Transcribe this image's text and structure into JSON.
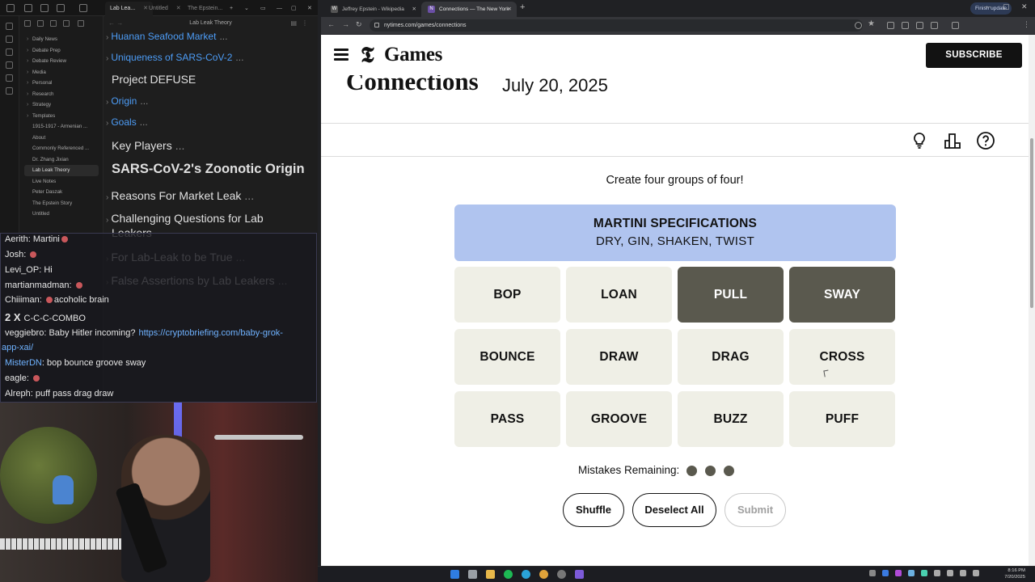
{
  "obsidian": {
    "tabs": [
      {
        "label": "Lab Lea..."
      },
      {
        "label": "Untitled"
      },
      {
        "label": "The Epstein..."
      }
    ],
    "note_title": "Lab Leak Theory",
    "file_tree": [
      {
        "label": "Daily News",
        "folder": true
      },
      {
        "label": "Debate Prep",
        "folder": true
      },
      {
        "label": "Debate Review",
        "folder": true
      },
      {
        "label": "Media",
        "folder": true
      },
      {
        "label": "Personal",
        "folder": true
      },
      {
        "label": "Research",
        "folder": true
      },
      {
        "label": "Strategy",
        "folder": true
      },
      {
        "label": "Templates",
        "folder": true
      },
      {
        "label": "1915-1917 - Armenian ...",
        "folder": false
      },
      {
        "label": "About",
        "folder": false
      },
      {
        "label": "Commonly Referenced ...",
        "folder": false
      },
      {
        "label": "Dr. Zhang Jixian",
        "folder": false
      },
      {
        "label": "Lab Leak Theory",
        "folder": false,
        "active": true
      },
      {
        "label": "Live Notes",
        "folder": false
      },
      {
        "label": "Peter Daszak",
        "folder": false
      },
      {
        "label": "The Epstein Story",
        "folder": false
      },
      {
        "label": "Untitled",
        "folder": false
      }
    ],
    "outline": [
      {
        "label": "Huanan Seafood Market",
        "link": true,
        "caret": true,
        "ell": "...",
        "size": 12
      },
      {
        "label": "Uniqueness of SARS-CoV-2",
        "link": true,
        "caret": true,
        "ell": "...",
        "size": 12
      },
      {
        "label": "Project DEFUSE",
        "link": false,
        "caret": false,
        "ell": "",
        "size": 14
      },
      {
        "label": "Origin",
        "link": true,
        "caret": true,
        "ell": "...",
        "size": 12
      },
      {
        "label": "Goals",
        "link": true,
        "caret": true,
        "ell": "...",
        "size": 12
      },
      {
        "label": "Key Players",
        "link": false,
        "caret": false,
        "ell": "...",
        "size": 14
      },
      {
        "label": "SARS-CoV-2's Zoonotic Origin",
        "link": false,
        "caret": false,
        "ell": "",
        "size": 16.5,
        "bold": true
      },
      {
        "label": "Reasons For Market Leak",
        "link": false,
        "caret": true,
        "ell": "...",
        "size": 14
      },
      {
        "label": "Challenging Questions for Lab",
        "link": false,
        "caret": true,
        "ell": "",
        "size": 14
      },
      {
        "label": "Leakers",
        "link": false,
        "caret": false,
        "ell": "",
        "size": 14
      },
      {
        "label": "For Lab-Leak to be True",
        "link": false,
        "caret": true,
        "ell": "...",
        "size": 14
      },
      {
        "label": "False Assertions by Lab Leakers",
        "link": false,
        "caret": true,
        "ell": "...",
        "size": 14
      }
    ]
  },
  "chat": {
    "messages": [
      {
        "user": "Aerith",
        "text": "Martini"
      },
      {
        "user": "Josh",
        "text": ""
      },
      {
        "user": "Levi_OP",
        "text": "Hi"
      },
      {
        "user": "martianmadman",
        "text": ""
      },
      {
        "user": "Chiiiman",
        "text": "acoholic brain"
      },
      {
        "combo_count": "2 X",
        "combo_text": "C-C-C-COMBO"
      },
      {
        "user": "veggiebro",
        "text": "Baby Hitler incoming?",
        "link": "https://cryptobriefing.com/baby-grok-",
        "link2": "app-xai/"
      },
      {
        "user": "MisterDN",
        "text": "bop bounce groove sway",
        "blue": true
      },
      {
        "user": "eagle",
        "text": ""
      },
      {
        "user": "Alreph",
        "text": "puff pass drag draw"
      }
    ]
  },
  "browser": {
    "tabs": [
      {
        "label": "Jeffrey Epstein - Wikipedia",
        "favicon": "W",
        "active": false
      },
      {
        "label": "Connections — The New York",
        "favicon": "N",
        "active": true
      }
    ],
    "url": "nytimes.com/games/connections",
    "update_label": "Finish update"
  },
  "nyt": {
    "brand": "Games",
    "subscribe": "SUBSCRIBE",
    "title": "Connections",
    "date": "July 20, 2025",
    "instructions": "Create four groups of four!",
    "solved": [
      {
        "category": "MARTINI SPECIFICATIONS",
        "words": "DRY, GIN, SHAKEN, TWIST",
        "color": "#b0c4ef"
      }
    ],
    "grid": [
      [
        {
          "word": "BOP",
          "selected": false
        },
        {
          "word": "LOAN",
          "selected": false
        },
        {
          "word": "PULL",
          "selected": true
        },
        {
          "word": "SWAY",
          "selected": true
        }
      ],
      [
        {
          "word": "BOUNCE",
          "selected": false
        },
        {
          "word": "DRAW",
          "selected": false
        },
        {
          "word": "DRAG",
          "selected": false
        },
        {
          "word": "CROSS",
          "selected": false
        }
      ],
      [
        {
          "word": "PASS",
          "selected": false
        },
        {
          "word": "GROOVE",
          "selected": false
        },
        {
          "word": "BUZZ",
          "selected": false
        },
        {
          "word": "PUFF",
          "selected": false
        }
      ]
    ],
    "mistakes_label": "Mistakes Remaining:",
    "mistakes_remaining": 3,
    "buttons": {
      "shuffle": "Shuffle",
      "deselect": "Deselect All",
      "submit": "Submit"
    },
    "submit_enabled": false
  },
  "taskbar": {
    "time": "8:16 PM",
    "date": "7/20/2025"
  }
}
